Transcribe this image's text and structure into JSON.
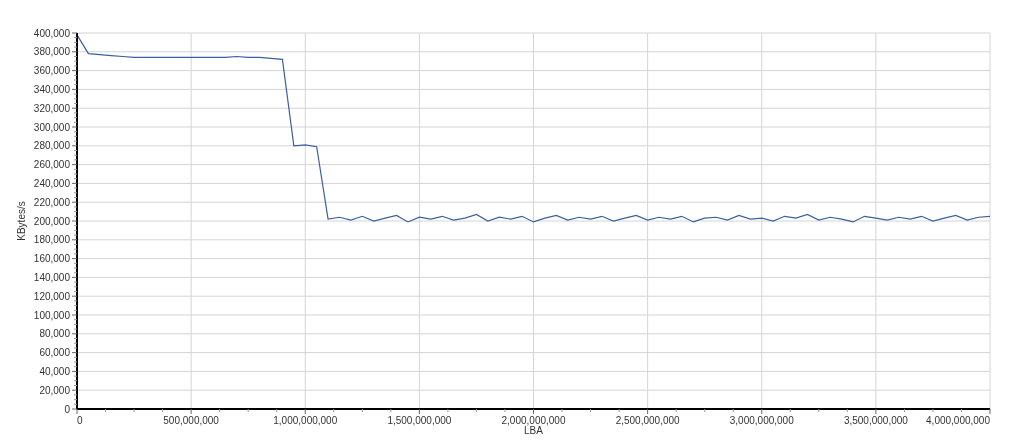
{
  "chart_data": {
    "type": "line",
    "grid": true,
    "xlabel": "LBA",
    "ylabel": "KBytes/s",
    "xlim": [
      0,
      4000000000
    ],
    "ylim": [
      0,
      400000
    ],
    "xticks": [
      {
        "value": 0,
        "label": "0"
      },
      {
        "value": 500000000,
        "label": "500,000,000"
      },
      {
        "value": 1000000000,
        "label": "1,000,000,000"
      },
      {
        "value": 1500000000,
        "label": "1,500,000,000"
      },
      {
        "value": 2000000000,
        "label": "2,000,000,000"
      },
      {
        "value": 2500000000,
        "label": "2,500,000,000"
      },
      {
        "value": 3000000000,
        "label": "3,000,000,000"
      },
      {
        "value": 3500000000,
        "label": "3,500,000,000"
      },
      {
        "value": 4000000000,
        "label": "4,000,000,000"
      }
    ],
    "yticks": [
      {
        "value": 0,
        "label": "0"
      },
      {
        "value": 20000,
        "label": "20,000"
      },
      {
        "value": 40000,
        "label": "40,000"
      },
      {
        "value": 60000,
        "label": "60,000"
      },
      {
        "value": 80000,
        "label": "80,000"
      },
      {
        "value": 100000,
        "label": "100,000"
      },
      {
        "value": 120000,
        "label": "120,000"
      },
      {
        "value": 140000,
        "label": "140,000"
      },
      {
        "value": 160000,
        "label": "160,000"
      },
      {
        "value": 180000,
        "label": "180,000"
      },
      {
        "value": 200000,
        "label": "200,000"
      },
      {
        "value": 220000,
        "label": "220,000"
      },
      {
        "value": 240000,
        "label": "240,000"
      },
      {
        "value": 260000,
        "label": "260,000"
      },
      {
        "value": 280000,
        "label": "280,000"
      },
      {
        "value": 300000,
        "label": "300,000"
      },
      {
        "value": 320000,
        "label": "320,000"
      },
      {
        "value": 340000,
        "label": "340,000"
      },
      {
        "value": 360000,
        "label": "360,000"
      },
      {
        "value": 380000,
        "label": "380,000"
      },
      {
        "value": 400000,
        "label": "400,000"
      }
    ],
    "x": [
      0,
      50000000,
      100000000,
      150000000,
      200000000,
      250000000,
      300000000,
      350000000,
      400000000,
      450000000,
      500000000,
      550000000,
      600000000,
      650000000,
      700000000,
      750000000,
      800000000,
      850000000,
      900000000,
      950000000,
      1000000000,
      1050000000,
      1100000000,
      1150000000,
      1200000000,
      1250000000,
      1300000000,
      1350000000,
      1400000000,
      1450000000,
      1500000000,
      1550000000,
      1600000000,
      1650000000,
      1700000000,
      1750000000,
      1800000000,
      1850000000,
      1900000000,
      1950000000,
      2000000000,
      2050000000,
      2100000000,
      2150000000,
      2200000000,
      2250000000,
      2300000000,
      2350000000,
      2400000000,
      2450000000,
      2500000000,
      2550000000,
      2600000000,
      2650000000,
      2700000000,
      2750000000,
      2800000000,
      2850000000,
      2900000000,
      2950000000,
      3000000000,
      3050000000,
      3100000000,
      3150000000,
      3200000000,
      3250000000,
      3300000000,
      3350000000,
      3400000000,
      3450000000,
      3500000000,
      3550000000,
      3600000000,
      3650000000,
      3700000000,
      3750000000,
      3800000000,
      3850000000,
      3900000000,
      3950000000,
      4000000000
    ],
    "series": [
      {
        "color": "#3c5fa0",
        "values": [
          398000,
          378000,
          377000,
          376000,
          375000,
          374000,
          374000,
          374000,
          374000,
          374000,
          374000,
          374000,
          374000,
          374000,
          375000,
          374000,
          374000,
          373000,
          372000,
          280000,
          281000,
          279000,
          202000,
          204000,
          201000,
          205000,
          200000,
          203000,
          206000,
          199000,
          204000,
          202000,
          205000,
          201000,
          203000,
          207000,
          200000,
          204000,
          202000,
          205000,
          199000,
          203000,
          206000,
          201000,
          204000,
          202000,
          205000,
          200000,
          203000,
          206000,
          201000,
          204000,
          202000,
          205000,
          199000,
          203000,
          204000,
          201000,
          206000,
          202000,
          203000,
          200000,
          205000,
          203000,
          207000,
          201000,
          204000,
          202000,
          199000,
          205000,
          203000,
          201000,
          204000,
          202000,
          205000,
          200000,
          203000,
          206000,
          201000,
          204000,
          205000
        ]
      }
    ]
  }
}
